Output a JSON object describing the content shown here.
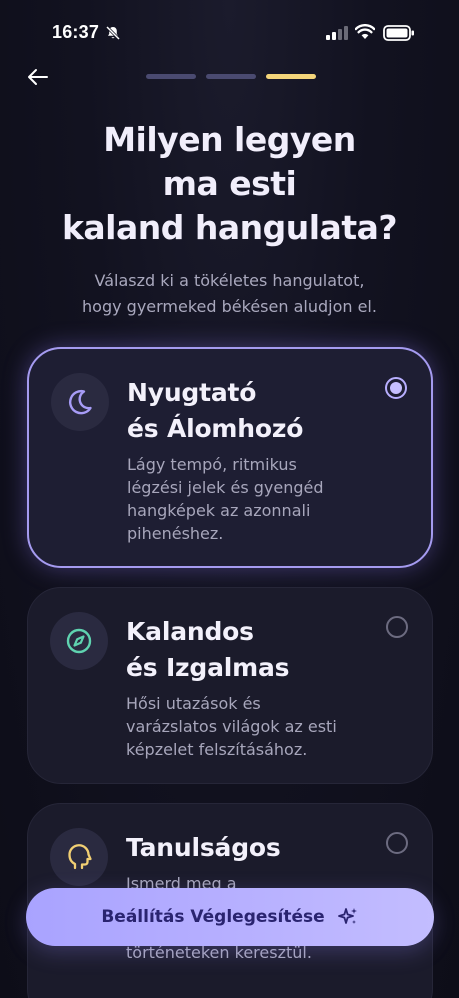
{
  "status_bar": {
    "time": "16:37"
  },
  "header": {
    "progress_steps": [
      {
        "active": false
      },
      {
        "active": false
      },
      {
        "active": true
      }
    ]
  },
  "title": "Milyen legyen\nma esti\nkaland hangulata?",
  "subtitle": "Válaszd ki a tökéletes hangulatot,\nhogy gyermeked békésen aludjon el.",
  "options": [
    {
      "title": "Nyugtató\nés Álomhozó",
      "description": "Lágy tempó, ritmikus\nlégzési jelek és gyengéd\nhangképek az azonnali\npihenéshez.",
      "icon": "moon-icon",
      "selected": true
    },
    {
      "title": "Kalandos\nés Izgalmas",
      "description": "Hősi utazások és\nvarázslatos világok az esti\nképzelet felszításához.",
      "icon": "compass-icon",
      "selected": false
    },
    {
      "title": "Tanulságos",
      "description": "Ismerd meg a\n\nszeszélyes tényeken és\ntörténeteken keresztül.",
      "icon": "head-icon",
      "selected": false
    }
  ],
  "cta": {
    "label": "Beállítás Véglegesítése",
    "icon": "sparkles-icon"
  },
  "colors": {
    "accent": "#a59bf0",
    "progress_active": "#f4d57a",
    "compass": "#5fd3b0",
    "head": "#f1cf73"
  }
}
